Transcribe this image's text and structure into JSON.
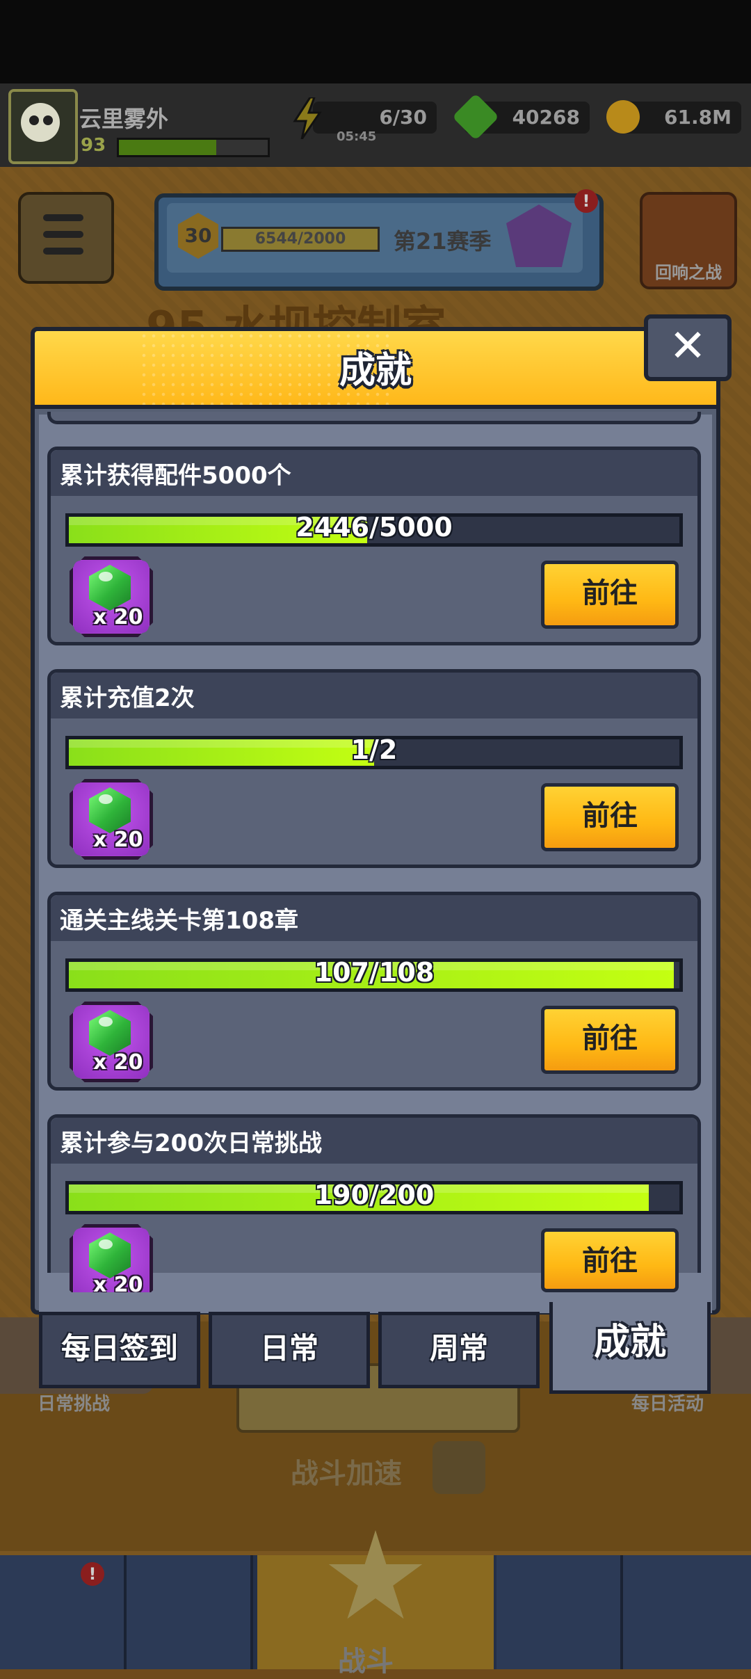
{
  "hud": {
    "player_name": "云里雾外",
    "player_level": "93",
    "energy": "6/30",
    "energy_timer": "05:45",
    "gems": "40268",
    "coins": "61.8M"
  },
  "season": {
    "level": "30",
    "progress": "6544/2000",
    "name": "第21赛季",
    "badge_alert": "!"
  },
  "background": {
    "echo_battle": "回响之战",
    "stage_title": "95 水坝控制室",
    "daily_challenge": "日常挑战",
    "daily_activity": "每日活动",
    "battle_speed": "战斗加速",
    "nav_fight": "战斗",
    "nav_alert": "!"
  },
  "modal": {
    "title": "成就",
    "close_symbol": "✕",
    "achievements": [
      {
        "title": "累计获得配件5000个",
        "progress_text": "2446/5000",
        "progress": 0.489,
        "reward_count": "x 20",
        "button": "前往"
      },
      {
        "title": "累计充值2次",
        "progress_text": "1/2",
        "progress": 0.5,
        "reward_count": "x 20",
        "button": "前往"
      },
      {
        "title": "通关主线关卡第108章",
        "progress_text": "107/108",
        "progress": 0.991,
        "reward_count": "x 20",
        "button": "前往"
      },
      {
        "title": "累计参与200次日常挑战",
        "progress_text": "190/200",
        "progress": 0.95,
        "reward_count": "x 20",
        "button": "前往"
      }
    ]
  },
  "tabs": {
    "daily_signin": "每日签到",
    "daily": "日常",
    "weekly": "周常",
    "achievements": "成就"
  },
  "colors": {
    "header_gold": "#ffc21a",
    "progress_green": "#b4f516",
    "reward_purple": "#a93ed4",
    "button_yellow": "#ffc01c"
  }
}
